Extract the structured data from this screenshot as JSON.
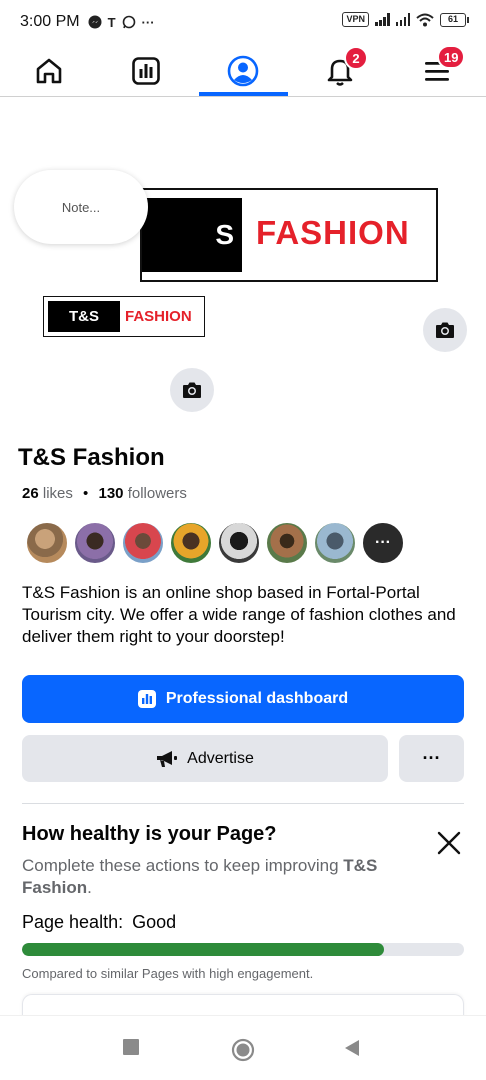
{
  "status_bar": {
    "time": "3:00 PM",
    "left_icons": [
      "messenger-icon",
      "t-icon",
      "whatsapp-icon",
      "more-dots-icon"
    ],
    "vpn": "VPN",
    "battery": "61"
  },
  "top_nav": {
    "items": [
      "home-icon",
      "insights-icon",
      "profile-icon",
      "notifications-icon",
      "menu-icon"
    ],
    "active": "profile-icon",
    "notifications_badge": "2",
    "menu_badge": "19"
  },
  "cover": {
    "logo_left": "S",
    "logo_right": "FASHION",
    "note_placeholder": "Note..."
  },
  "profile_logo": {
    "left": "T&S",
    "right": "FASHION"
  },
  "page": {
    "name": "T&S Fashion",
    "likes_count": "26",
    "likes_label": "likes",
    "separator": "•",
    "followers_count": "130",
    "followers_label": "followers",
    "description": "T&S Fashion is an online shop based in Fortal-Portal Tourism city. We offer a wide range  of fashion clothes and deliver them right to your doorstep!",
    "more_avatars_label": "···"
  },
  "buttons": {
    "professional_dashboard": "Professional dashboard",
    "advertise": "Advertise",
    "more": "···"
  },
  "health": {
    "title": "How healthy is your Page?",
    "subtitle_prefix": "Complete these actions to keep improving ",
    "subtitle_page": "T&S Fashion",
    "subtitle_suffix": ".",
    "status_label": "Page health:",
    "status_value": "Good",
    "progress_fraction": 0.82,
    "note": "Compared to similar Pages with high engagement."
  },
  "colors": {
    "brand_blue": "#0866ff",
    "badge_red": "#e41e3f",
    "health_green": "#2e8b3a",
    "logo_red": "#e5212a"
  }
}
